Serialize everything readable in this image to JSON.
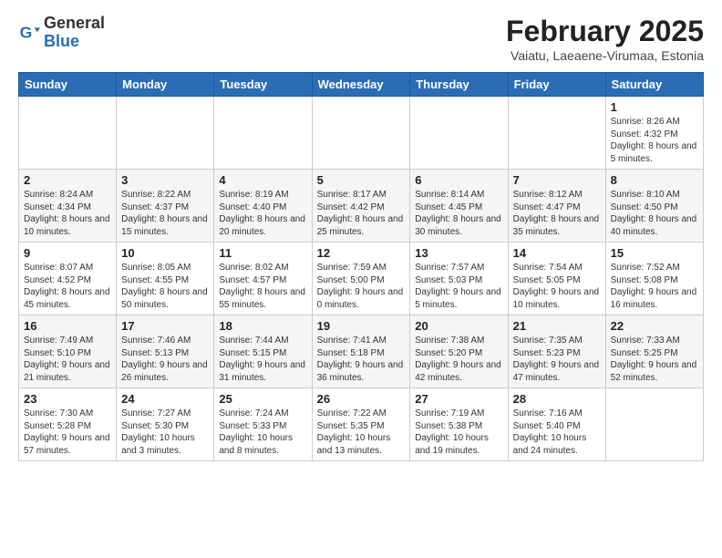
{
  "header": {
    "logo_general": "General",
    "logo_blue": "Blue",
    "month_year": "February 2025",
    "location": "Vaiatu, Laeaene-Virumaa, Estonia"
  },
  "days_of_week": [
    "Sunday",
    "Monday",
    "Tuesday",
    "Wednesday",
    "Thursday",
    "Friday",
    "Saturday"
  ],
  "weeks": [
    {
      "shade": false,
      "days": [
        {
          "num": "",
          "detail": ""
        },
        {
          "num": "",
          "detail": ""
        },
        {
          "num": "",
          "detail": ""
        },
        {
          "num": "",
          "detail": ""
        },
        {
          "num": "",
          "detail": ""
        },
        {
          "num": "",
          "detail": ""
        },
        {
          "num": "1",
          "detail": "Sunrise: 8:26 AM\nSunset: 4:32 PM\nDaylight: 8 hours and 5 minutes."
        }
      ]
    },
    {
      "shade": true,
      "days": [
        {
          "num": "2",
          "detail": "Sunrise: 8:24 AM\nSunset: 4:34 PM\nDaylight: 8 hours and 10 minutes."
        },
        {
          "num": "3",
          "detail": "Sunrise: 8:22 AM\nSunset: 4:37 PM\nDaylight: 8 hours and 15 minutes."
        },
        {
          "num": "4",
          "detail": "Sunrise: 8:19 AM\nSunset: 4:40 PM\nDaylight: 8 hours and 20 minutes."
        },
        {
          "num": "5",
          "detail": "Sunrise: 8:17 AM\nSunset: 4:42 PM\nDaylight: 8 hours and 25 minutes."
        },
        {
          "num": "6",
          "detail": "Sunrise: 8:14 AM\nSunset: 4:45 PM\nDaylight: 8 hours and 30 minutes."
        },
        {
          "num": "7",
          "detail": "Sunrise: 8:12 AM\nSunset: 4:47 PM\nDaylight: 8 hours and 35 minutes."
        },
        {
          "num": "8",
          "detail": "Sunrise: 8:10 AM\nSunset: 4:50 PM\nDaylight: 8 hours and 40 minutes."
        }
      ]
    },
    {
      "shade": false,
      "days": [
        {
          "num": "9",
          "detail": "Sunrise: 8:07 AM\nSunset: 4:52 PM\nDaylight: 8 hours and 45 minutes."
        },
        {
          "num": "10",
          "detail": "Sunrise: 8:05 AM\nSunset: 4:55 PM\nDaylight: 8 hours and 50 minutes."
        },
        {
          "num": "11",
          "detail": "Sunrise: 8:02 AM\nSunset: 4:57 PM\nDaylight: 8 hours and 55 minutes."
        },
        {
          "num": "12",
          "detail": "Sunrise: 7:59 AM\nSunset: 5:00 PM\nDaylight: 9 hours and 0 minutes."
        },
        {
          "num": "13",
          "detail": "Sunrise: 7:57 AM\nSunset: 5:03 PM\nDaylight: 9 hours and 5 minutes."
        },
        {
          "num": "14",
          "detail": "Sunrise: 7:54 AM\nSunset: 5:05 PM\nDaylight: 9 hours and 10 minutes."
        },
        {
          "num": "15",
          "detail": "Sunrise: 7:52 AM\nSunset: 5:08 PM\nDaylight: 9 hours and 16 minutes."
        }
      ]
    },
    {
      "shade": true,
      "days": [
        {
          "num": "16",
          "detail": "Sunrise: 7:49 AM\nSunset: 5:10 PM\nDaylight: 9 hours and 21 minutes."
        },
        {
          "num": "17",
          "detail": "Sunrise: 7:46 AM\nSunset: 5:13 PM\nDaylight: 9 hours and 26 minutes."
        },
        {
          "num": "18",
          "detail": "Sunrise: 7:44 AM\nSunset: 5:15 PM\nDaylight: 9 hours and 31 minutes."
        },
        {
          "num": "19",
          "detail": "Sunrise: 7:41 AM\nSunset: 5:18 PM\nDaylight: 9 hours and 36 minutes."
        },
        {
          "num": "20",
          "detail": "Sunrise: 7:38 AM\nSunset: 5:20 PM\nDaylight: 9 hours and 42 minutes."
        },
        {
          "num": "21",
          "detail": "Sunrise: 7:35 AM\nSunset: 5:23 PM\nDaylight: 9 hours and 47 minutes."
        },
        {
          "num": "22",
          "detail": "Sunrise: 7:33 AM\nSunset: 5:25 PM\nDaylight: 9 hours and 52 minutes."
        }
      ]
    },
    {
      "shade": false,
      "days": [
        {
          "num": "23",
          "detail": "Sunrise: 7:30 AM\nSunset: 5:28 PM\nDaylight: 9 hours and 57 minutes."
        },
        {
          "num": "24",
          "detail": "Sunrise: 7:27 AM\nSunset: 5:30 PM\nDaylight: 10 hours and 3 minutes."
        },
        {
          "num": "25",
          "detail": "Sunrise: 7:24 AM\nSunset: 5:33 PM\nDaylight: 10 hours and 8 minutes."
        },
        {
          "num": "26",
          "detail": "Sunrise: 7:22 AM\nSunset: 5:35 PM\nDaylight: 10 hours and 13 minutes."
        },
        {
          "num": "27",
          "detail": "Sunrise: 7:19 AM\nSunset: 5:38 PM\nDaylight: 10 hours and 19 minutes."
        },
        {
          "num": "28",
          "detail": "Sunrise: 7:16 AM\nSunset: 5:40 PM\nDaylight: 10 hours and 24 minutes."
        },
        {
          "num": "",
          "detail": ""
        }
      ]
    }
  ]
}
